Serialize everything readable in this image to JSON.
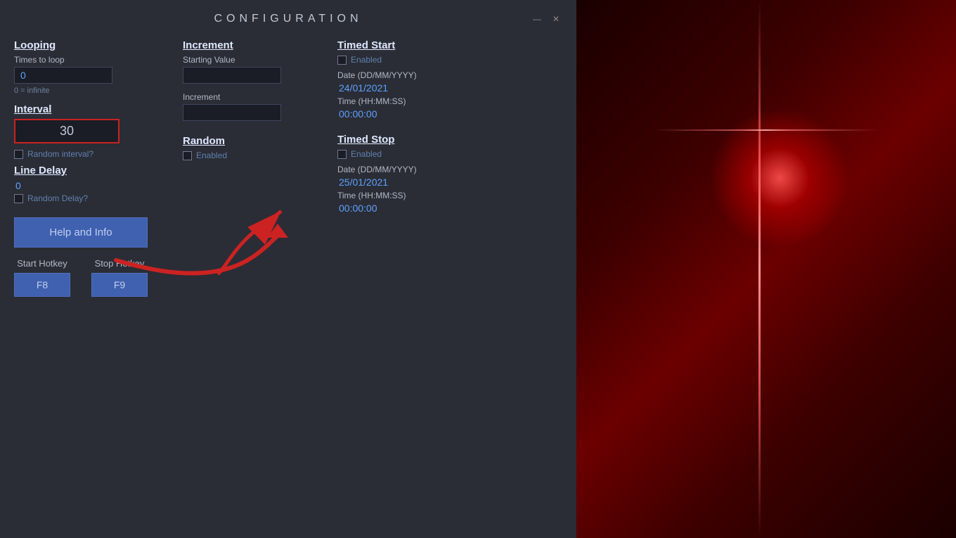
{
  "window": {
    "title": "CONFIGURATION",
    "minimize_btn": "—",
    "close_btn": "✕"
  },
  "looping": {
    "title": "Looping",
    "times_label": "Times to loop",
    "times_value": "0",
    "infinite_note": "0 = infinite"
  },
  "interval": {
    "title": "Interval",
    "value": "30",
    "checkbox_label": "Random interval?"
  },
  "line_delay": {
    "title": "Line Delay",
    "value": "0",
    "checkbox_label": "Random Delay?"
  },
  "increment": {
    "title": "Increment",
    "starting_label": "Starting Value",
    "starting_value": "",
    "increment_label": "Increment",
    "increment_value": ""
  },
  "random": {
    "title": "Random",
    "checkbox_label": "Enabled"
  },
  "timed_start": {
    "title": "Timed Start",
    "checkbox_label": "Enabled",
    "date_label": "Date (DD/MM/YYYY)",
    "date_value": "24/01/2021",
    "time_label": "Time (HH:MM:SS)",
    "time_value": "00:00:00"
  },
  "timed_stop": {
    "title": "Timed Stop",
    "checkbox_label": "Enabled",
    "date_label": "Date (DD/MM/YYYY)",
    "date_value": "25/01/2021",
    "time_label": "Time (HH:MM:SS)",
    "time_value": "00:00:00"
  },
  "buttons": {
    "help_label": "Help and Info",
    "start_hotkey_label": "Start Hotkey",
    "start_hotkey_value": "F8",
    "stop_hotkey_label": "Stop Hotkey",
    "stop_hotkey_value": "F9"
  }
}
